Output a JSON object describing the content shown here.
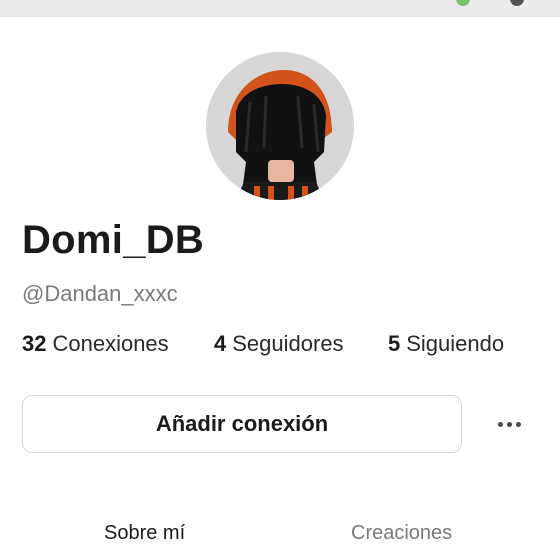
{
  "profile": {
    "display_name": "Domi_DB",
    "username": "@Dandan_xxxc"
  },
  "stats": [
    {
      "count": "32",
      "label": "Conexiones"
    },
    {
      "count": "4",
      "label": "Seguidores"
    },
    {
      "count": "5",
      "label": "Siguiendo"
    }
  ],
  "actions": {
    "add_connection_label": "Añadir conexión",
    "more_icon": "more-horizontal-icon"
  },
  "tabs": [
    {
      "label": "Sobre mí",
      "active": true
    },
    {
      "label": "Creaciones",
      "active": false
    }
  ],
  "colors": {
    "background": "#ffffff",
    "text_primary": "#1b1b1b",
    "text_secondary": "#7a7a7a",
    "button_border": "#d9d9d9",
    "avatar_bg": "#d7d7d7",
    "hat_orange": "#d2531c",
    "hair_black": "#111111"
  }
}
